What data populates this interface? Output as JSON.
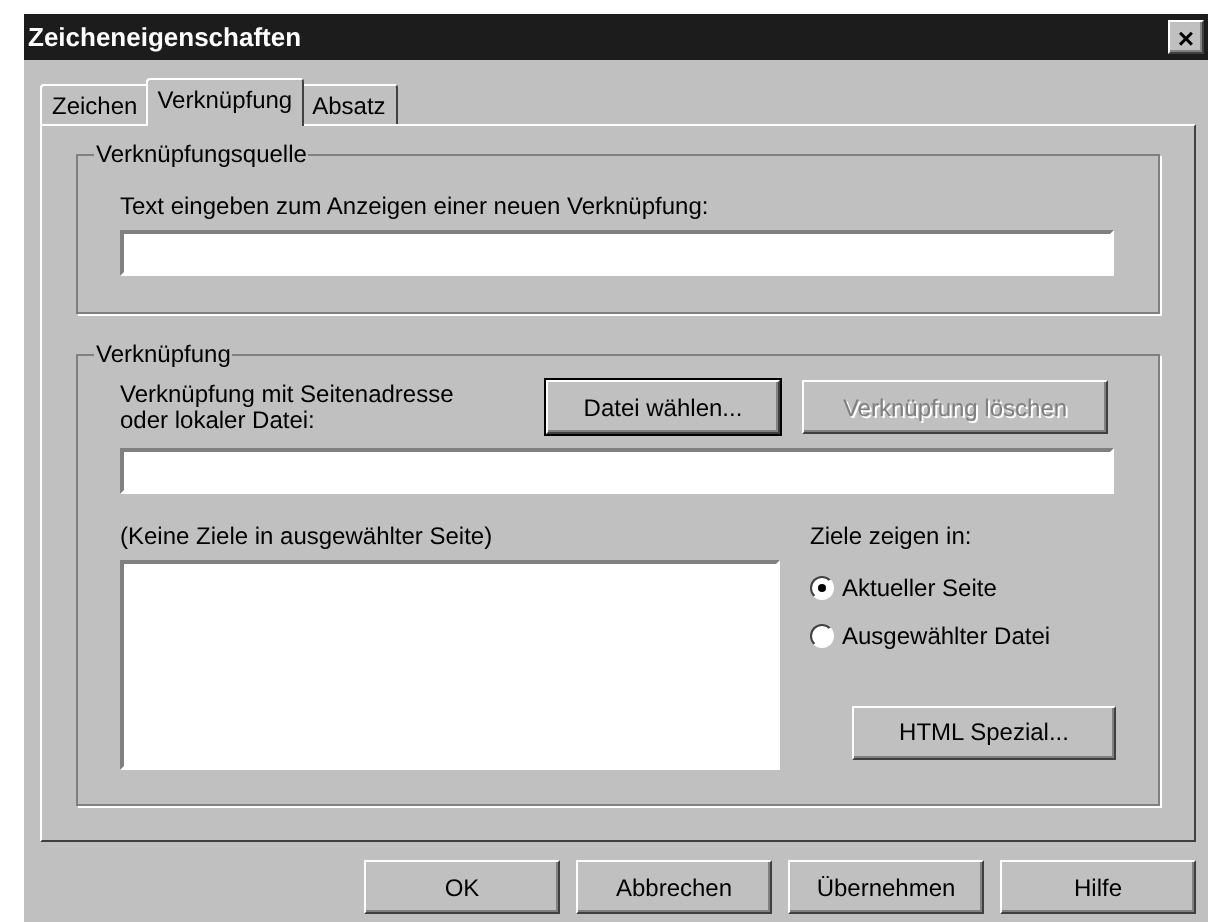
{
  "window": {
    "title": "Zeicheneigenschaften",
    "close": "×"
  },
  "tabs": [
    {
      "label": "Zeichen",
      "selected": false
    },
    {
      "label": "Verknüpfung",
      "selected": true
    },
    {
      "label": "Absatz",
      "selected": false
    }
  ],
  "source_group": {
    "title": "Verknüpfungsquelle",
    "field_label": "Text eingeben zum Anzeigen einer neuen Verknüpfung:"
  },
  "link_group": {
    "title": "Verknüpfung",
    "field_label": "Verknüpfung mit Seitenadresse oder lokaler Datei:",
    "buttons": [
      {
        "label": "Datei wählen...",
        "disabled": false,
        "focused": true
      },
      {
        "label": "Verknüpfung löschen",
        "disabled": true,
        "focused": false
      }
    ],
    "targets_label": "(Keine Ziele in ausgewählter Seite)",
    "show_in_label": "Ziele zeigen in:",
    "radios": [
      {
        "label": "Aktueller Seite",
        "selected": true
      },
      {
        "label": "Ausgewählter Datei",
        "selected": false
      }
    ],
    "special_button": "HTML Spezial..."
  },
  "buttons": [
    "OK",
    "Abbrechen",
    "Übernehmen",
    "Hilfe"
  ]
}
